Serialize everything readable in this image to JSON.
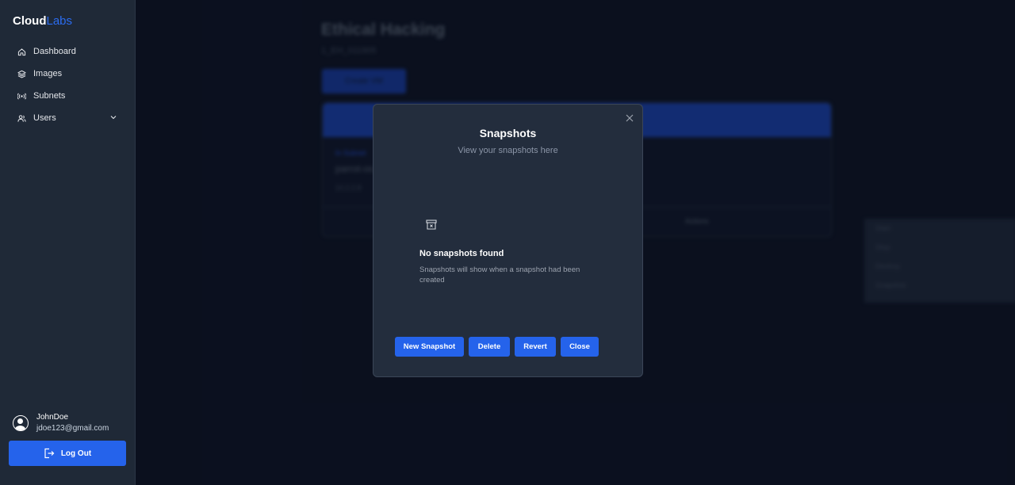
{
  "sidebar": {
    "brand_part1": "Cloud",
    "brand_part2": "Labs",
    "items": [
      {
        "label": "Dashboard",
        "icon": "home-icon"
      },
      {
        "label": "Images",
        "icon": "layers-icon"
      },
      {
        "label": "Subnets",
        "icon": "broadcast-icon"
      },
      {
        "label": "Users",
        "icon": "users-icon"
      }
    ],
    "user": {
      "name": "JohnDoe",
      "email": "jdoe123@gmail.com"
    },
    "logout_label": "Log Out"
  },
  "background": {
    "title": "Ethical Hacking",
    "subtitle": "1_EH_011905",
    "create_label": "Create VM",
    "card": {
      "tag": "In Subnet",
      "name": "parrot-os",
      "ip": "10.2.2.8",
      "actions_label": "Actions"
    },
    "menu": [
      "Start",
      "Stop",
      "Destroy",
      "Snapshot"
    ]
  },
  "modal": {
    "title": "Snapshots",
    "subtitle": "View your snapshots here",
    "empty_title": "No snapshots found",
    "empty_text": "Snapshots will show when a snapshot had been created",
    "buttons": {
      "new": "New Snapshot",
      "delete": "Delete",
      "revert": "Revert",
      "close": "Close"
    }
  },
  "colors": {
    "accent": "#2563eb",
    "sidebar_bg": "#1f2937",
    "page_bg": "#0c1221",
    "modal_bg": "#232d3d"
  }
}
